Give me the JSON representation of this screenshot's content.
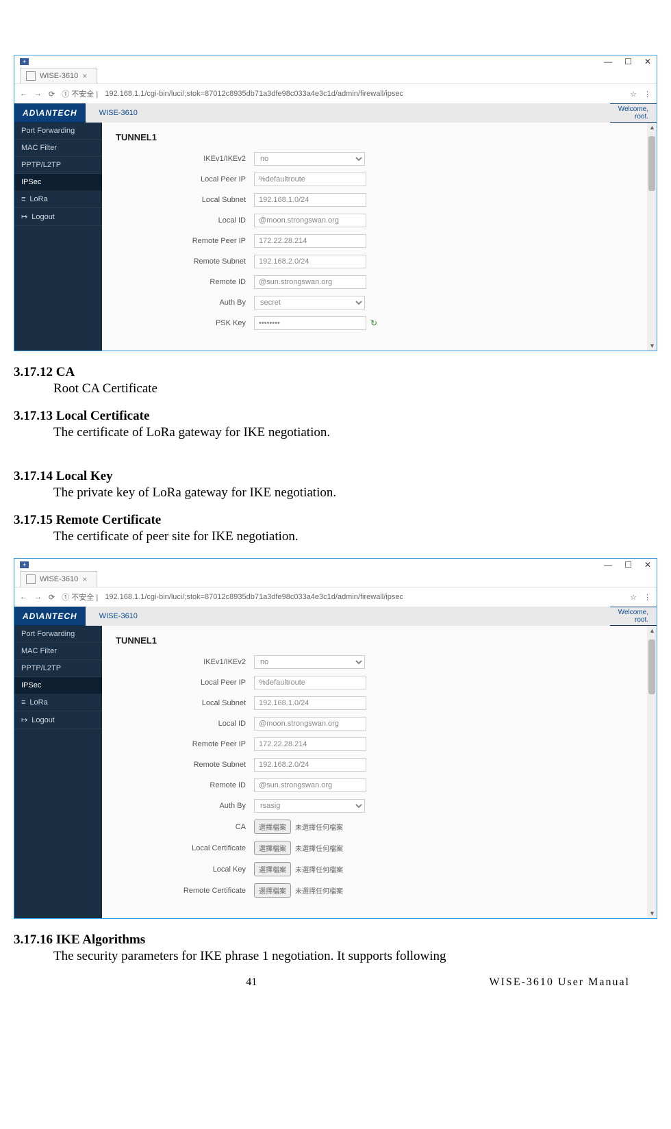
{
  "screenshot_common": {
    "tab_title": "WISE-3610",
    "win_minimize": "—",
    "win_restore": "☐",
    "win_close": "✕",
    "nav_back": "←",
    "nav_fwd": "→",
    "nav_reload": "⟳",
    "addr_prefix": "① 不安全 |",
    "url": "192.168.1.1/cgi-bin/luci/;stok=87012c8935db71a3dfe98c033a4e3c1d/admin/firewall/ipsec",
    "menu_dots": "⋮",
    "star": "☆",
    "logo": "AD\\ANTECH",
    "breadcrumb": "WISE-3610",
    "welcome1": "Welcome,",
    "welcome2": "root.",
    "sidebar": {
      "portfwd": "Port Forwarding",
      "macfilter": "MAC Filter",
      "pptp": "PPTP/L2TP",
      "ipsec": "IPSec",
      "lora": "LoRa",
      "lora_icon": "≡",
      "logout": "Logout",
      "logout_icon": "↦"
    }
  },
  "screenshot1": {
    "title": "TUNNEL1",
    "labels": {
      "ikev": "IKEv1/IKEv2",
      "local_peer_ip": "Local Peer IP",
      "local_subnet": "Local Subnet",
      "local_id": "Local ID",
      "remote_peer_ip": "Remote Peer IP",
      "remote_subnet": "Remote Subnet",
      "remote_id": "Remote ID",
      "auth_by": "Auth By",
      "psk_key": "PSK Key"
    },
    "values": {
      "ikev": "no",
      "local_peer_ip": "%defaultroute",
      "local_subnet": "192.168.1.0/24",
      "local_id": "@moon.strongswan.org",
      "remote_peer_ip": "172.22.28.214",
      "remote_subnet": "192.168.2.0/24",
      "remote_id": "@sun.strongswan.org",
      "auth_by": "secret",
      "psk_key": "••••••••",
      "reload": "↻"
    }
  },
  "doc": {
    "s12_h": "3.17.12 CA",
    "s12_b": "Root CA Certificate",
    "s13_h": "3.17.13 Local Certificate",
    "s13_b": "The certificate of LoRa gateway for IKE negotiation.",
    "s14_h": "3.17.14 Local Key",
    "s14_b": "The private key of LoRa gateway for IKE negotiation.",
    "s15_h": "3.17.15 Remote Certificate",
    "s15_b": "The certificate of peer site for IKE negotiation.",
    "s16_h": "3.17.16 IKE Algorithms",
    "s16_b": "The  security  parameters  for  IKE  phrase  1  negotiation.  It  supports  following"
  },
  "screenshot2": {
    "title": "TUNNEL1",
    "labels": {
      "ikev": "IKEv1/IKEv2",
      "local_peer_ip": "Local Peer IP",
      "local_subnet": "Local Subnet",
      "local_id": "Local ID",
      "remote_peer_ip": "Remote Peer IP",
      "remote_subnet": "Remote Subnet",
      "remote_id": "Remote ID",
      "auth_by": "Auth By",
      "ca": "CA",
      "local_cert": "Local Certificate",
      "local_key": "Local Key",
      "remote_cert": "Remote Certificate"
    },
    "values": {
      "ikev": "no",
      "local_peer_ip": "%defaultroute",
      "local_subnet": "192.168.1.0/24",
      "local_id": "@moon.strongswan.org",
      "remote_peer_ip": "172.22.28.214",
      "remote_subnet": "192.168.2.0/24",
      "remote_id": "@sun.strongswan.org",
      "auth_by": "rsasig",
      "file_btn": "選擇檔案",
      "file_hint": "未選擇任何檔案"
    }
  },
  "footer": {
    "page": "41",
    "manual": "WISE-3610  User  Manual"
  }
}
